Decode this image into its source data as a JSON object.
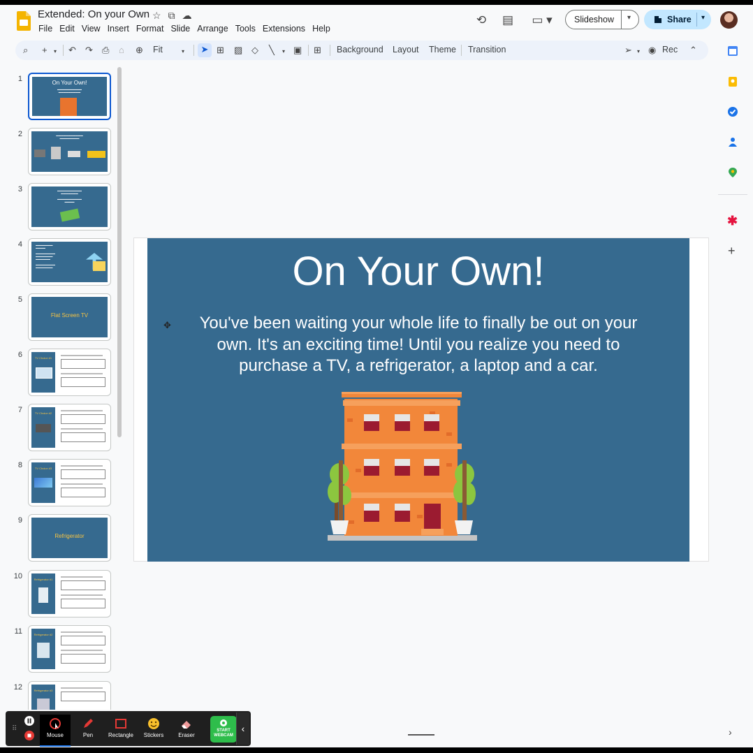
{
  "document": {
    "title": "Extended: On your Own"
  },
  "menu": [
    "File",
    "Edit",
    "View",
    "Insert",
    "Format",
    "Slide",
    "Arrange",
    "Tools",
    "Extensions",
    "Help"
  ],
  "header": {
    "slideshow_label": "Slideshow",
    "share_label": "Share"
  },
  "toolbar": {
    "zoom_label": "Fit",
    "background_label": "Background",
    "layout_label": "Layout",
    "theme_label": "Theme",
    "transition_label": "Transition",
    "rec_label": "Rec"
  },
  "filmstrip": {
    "slides": [
      {
        "number": "1",
        "title": "On Your Own!",
        "selected": true
      },
      {
        "number": "2"
      },
      {
        "number": "3"
      },
      {
        "number": "4"
      },
      {
        "number": "5",
        "title": "Flat Screen TV"
      },
      {
        "number": "6",
        "title": "TV Choice #1"
      },
      {
        "number": "7",
        "title": "TV Choice #2"
      },
      {
        "number": "8",
        "title": "TV Choice #3"
      },
      {
        "number": "9",
        "title": "Refrigerator"
      },
      {
        "number": "10",
        "title": "Refrigerator #1"
      },
      {
        "number": "11",
        "title": "Refrigerator #2"
      },
      {
        "number": "12",
        "title": "Refrigerator #3"
      }
    ]
  },
  "slide": {
    "title": "On Your Own!",
    "body": "You've been waiting your whole life to finally be out on your own. It's an exciting time! Until you realize you need to purchase a TV, a refrigerator, a laptop and a car.",
    "background_color": "#366a8f"
  },
  "recorder": {
    "tools": [
      "Mouse",
      "Pen",
      "Rectangle",
      "Stickers",
      "Eraser"
    ],
    "webcam_label_1": "START",
    "webcam_label_2": "WEBCAM",
    "selected_tool": "Mouse"
  },
  "colors": {
    "accent_blue": "#0b57d0",
    "share_bg": "#c2e7ff",
    "slide_bg": "#366a8f",
    "webcam_green": "#2ebd4b"
  }
}
